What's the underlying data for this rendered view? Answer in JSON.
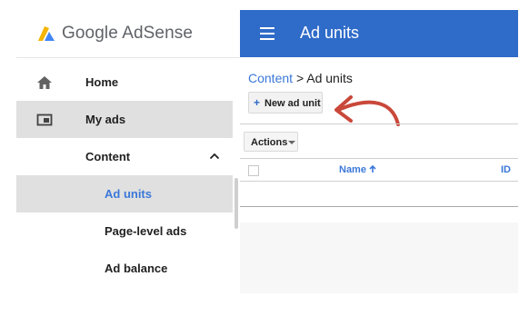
{
  "brand": {
    "name": "Google AdSense",
    "logo_colors": [
      "#f4b400",
      "#4285f4"
    ]
  },
  "sidebar": {
    "items": [
      {
        "label": "Home",
        "icon": "home-icon",
        "active": false
      },
      {
        "label": "My ads",
        "icon": "ad-unit-icon",
        "active": true
      },
      {
        "label": "Content",
        "icon": "chevron-up-icon",
        "expanded": true
      },
      {
        "label": "Ad units",
        "active": true
      },
      {
        "label": "Page-level ads",
        "active": false
      },
      {
        "label": "Ad balance",
        "active": false
      }
    ]
  },
  "header": {
    "menu_icon": "hamburger-icon",
    "title": "Ad units",
    "color": "#2f6bc8"
  },
  "breadcrumb": {
    "link": "Content",
    "separator": ">",
    "current": "Ad units"
  },
  "toolbar": {
    "new_ad_unit": "New ad unit",
    "new_icon": "plus-icon",
    "actions": "Actions",
    "annotation": "red-arrow",
    "annotation_color": "#c9483a"
  },
  "table": {
    "columns": [
      {
        "label": "Name",
        "sort": "ascending"
      },
      {
        "label": "ID"
      }
    ]
  }
}
